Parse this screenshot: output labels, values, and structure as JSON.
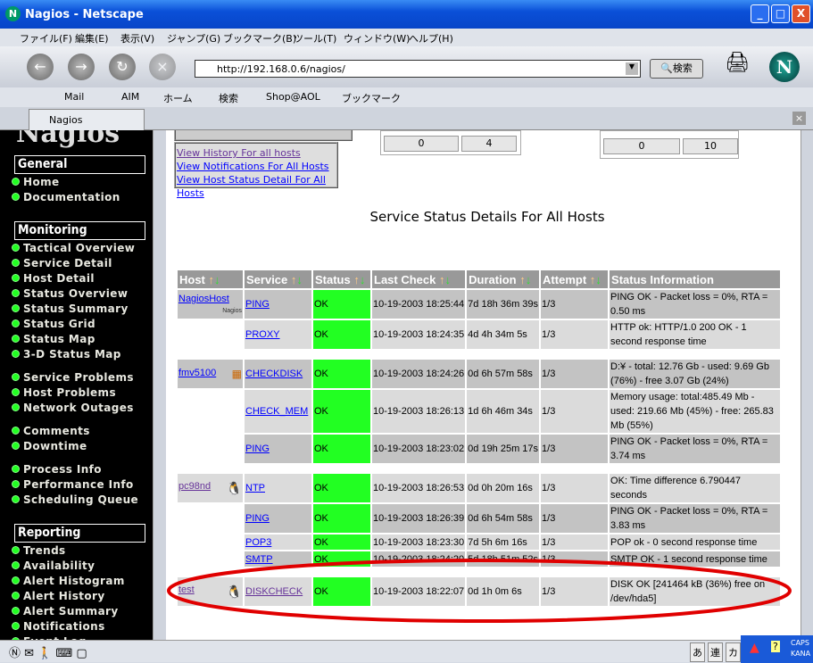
{
  "window": {
    "title": "Nagios - Netscape",
    "min": "_",
    "max": "□",
    "close": "X"
  },
  "menu": [
    "ファイル(F)",
    "編集(E)",
    "表示(V)",
    "ジャンプ(G)",
    "ブックマーク(B)",
    "ツール(T)",
    "ウィンドウ(W)",
    "ヘルプ(H)"
  ],
  "nav": {
    "url": "http://192.168.0.6/nagios/",
    "search": "検索"
  },
  "personal": [
    "Mail",
    "AIM",
    "ホーム",
    "検索",
    "Shop@AOL",
    "ブックマーク"
  ],
  "tab": {
    "label": "Nagios"
  },
  "sidebar": {
    "logo": "Nagios",
    "sections": [
      {
        "title": "General",
        "items": [
          [
            "Home",
            "Documentation"
          ]
        ]
      },
      {
        "title": "Monitoring",
        "items": [
          [
            "Tactical Overview",
            "Service Detail",
            "Host Detail",
            "Status Overview",
            "Status Summary",
            "Status Grid",
            "Status Map",
            "3-D Status Map"
          ],
          [
            "Service Problems",
            "Host Problems",
            "Network Outages"
          ],
          [
            "Comments",
            "Downtime"
          ],
          [
            "Process Info",
            "Performance Info",
            "Scheduling Queue"
          ]
        ]
      },
      {
        "title": "Reporting",
        "items": [
          [
            "Trends",
            "Availability",
            "Alert Histogram",
            "Alert History",
            "Alert Summary",
            "Notifications",
            "Event Log"
          ]
        ]
      }
    ]
  },
  "summary": {
    "host_totals": [
      "0",
      "4"
    ],
    "service_totals": [
      "0",
      "10"
    ]
  },
  "links": [
    "View History For all hosts",
    "View Notifications For All Hosts",
    "View Host Status Detail For All Hosts"
  ],
  "page_title": "Service Status Details For All Hosts",
  "table": {
    "headers": [
      "Host",
      "Service",
      "Status",
      "Last Check",
      "Duration",
      "Attempt",
      "Status Information"
    ],
    "groups": [
      {
        "host": "NagiosHost",
        "icon": "nagios-logo",
        "rows": [
          [
            "PING",
            "OK",
            "10-19-2003 18:25:44",
            "7d 18h 36m 39s",
            "1/3",
            "PING OK - Packet loss = 0%, RTA = 0.50 ms"
          ],
          [
            "PROXY",
            "OK",
            "10-19-2003 18:24:35",
            "4d 4h 34m 5s",
            "1/3",
            "HTTP ok: HTTP/1.0 200 OK - 1 second response time"
          ]
        ]
      },
      {
        "host": "fmv5100",
        "icon": "windows-icon",
        "rows": [
          [
            "CHECKDISK",
            "OK",
            "10-19-2003 18:24:26",
            "0d 6h 57m 58s",
            "1/3",
            "D:¥ - total: 12.76 Gb - used: 9.69 Gb (76%) - free 3.07 Gb (24%)"
          ],
          [
            "CHECK_MEM",
            "OK",
            "10-19-2003 18:26:13",
            "1d 6h 46m 34s",
            "1/3",
            "Memory usage: total:485.49 Mb - used: 219.66 Mb (45%) - free: 265.83 Mb (55%)"
          ],
          [
            "PING",
            "OK",
            "10-19-2003 18:23:02",
            "0d 19h 25m 17s",
            "1/3",
            "PING OK - Packet loss = 0%, RTA = 3.74 ms"
          ]
        ]
      },
      {
        "host": "pc98nd",
        "icon": "linux-penguin-icon",
        "rows": [
          [
            "NTP",
            "OK",
            "10-19-2003 18:26:53",
            "0d 0h 20m 16s",
            "1/3",
            "OK: Time difference 6.790447 seconds"
          ],
          [
            "PING",
            "OK",
            "10-19-2003 18:26:39",
            "0d 6h 54m 58s",
            "1/3",
            "PING OK - Packet loss = 0%, RTA = 3.83 ms"
          ],
          [
            "POP3",
            "OK",
            "10-19-2003 18:23:30",
            "7d 5h 6m 16s",
            "1/3",
            "POP ok - 0 second response time"
          ],
          [
            "SMTP",
            "OK",
            "10-19-2003 18:24:20",
            "5d 18h 51m 52s",
            "1/3",
            "SMTP OK - 1 second response time"
          ]
        ]
      },
      {
        "host": "test",
        "icon": "linux-penguin-icon",
        "rows": [
          [
            "DISKCHECK",
            "OK",
            "10-19-2003 18:22:07",
            "0d 1h 0m 6s",
            "1/3",
            "DISK OK [241464 kB (36%) free on /dev/hda5]"
          ]
        ]
      }
    ]
  },
  "colors": {
    "ok": "#22ff22",
    "row_dark": "#c3c3c3",
    "row_light": "#dbdbdb",
    "header": "#999999",
    "annotation": "#e00000"
  },
  "tray": {
    "ime": [
      "あ",
      "連",
      "カ"
    ],
    "caps": "CAPS",
    "kana": "KANA"
  }
}
